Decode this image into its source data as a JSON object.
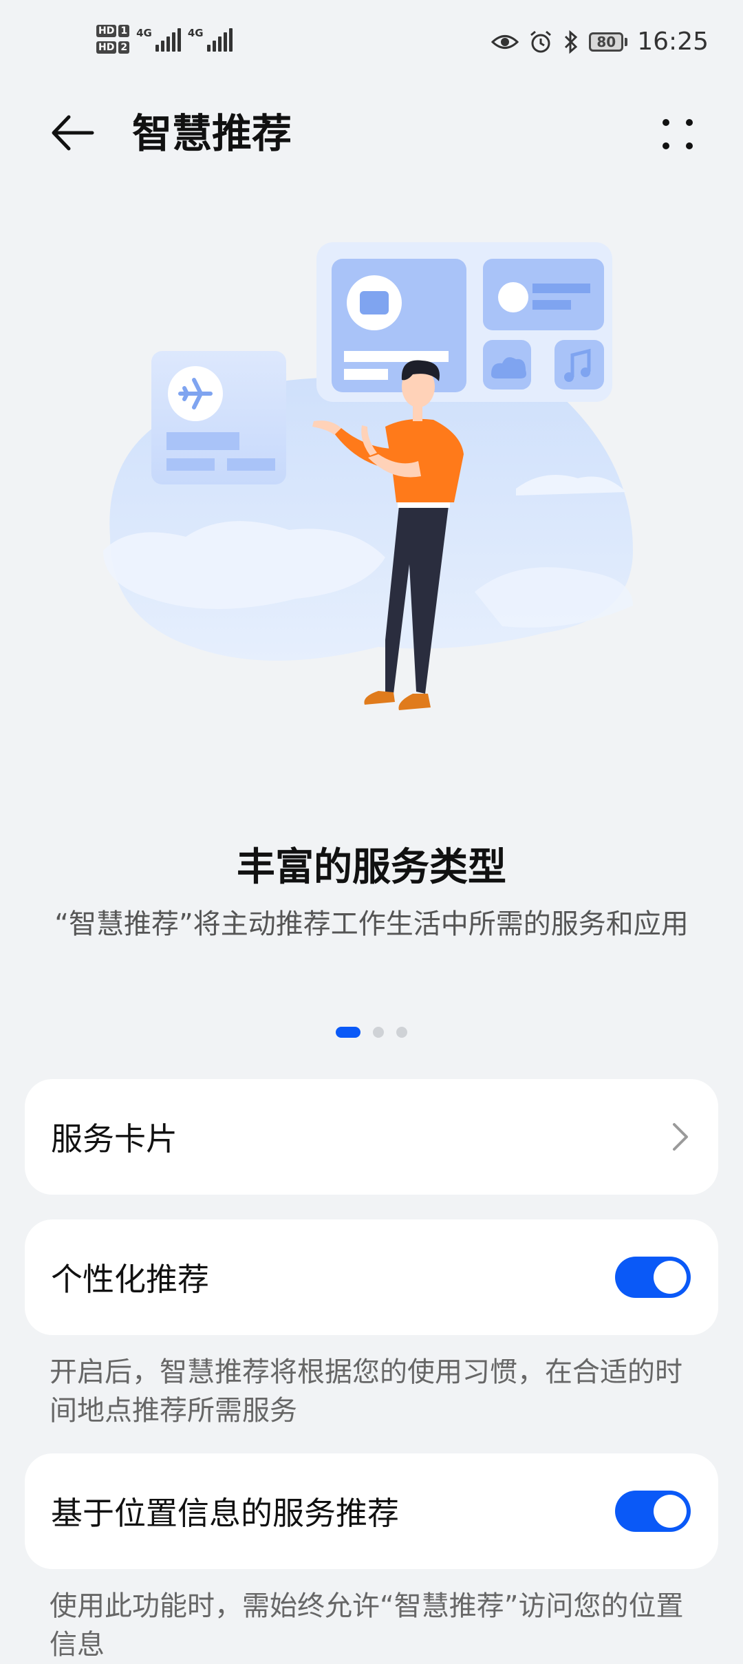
{
  "status_bar": {
    "sim1": {
      "hd": "HD",
      "num": "1"
    },
    "sim2": {
      "hd": "HD",
      "num": "2"
    },
    "signal1_label": "4G",
    "signal2_label": "4G",
    "battery": "80",
    "time": "16:25"
  },
  "app_bar": {
    "title": "智慧推荐"
  },
  "slide": {
    "title": "丰富的服务类型",
    "description": "“智慧推荐”将主动推荐工作生活中所需的服务和应用",
    "page_count": 3,
    "active_index": 0
  },
  "settings": {
    "service_cards": {
      "label": "服务卡片"
    },
    "personalized": {
      "label": "个性化推荐",
      "enabled": true,
      "note": "开启后，智慧推荐将根据您的使用习惯，在合适的时间地点推荐所需服务"
    },
    "location_based": {
      "label": "基于位置信息的服务推荐",
      "enabled": true,
      "note": "使用此功能时，需始终允许“智慧推荐”访问您的位置信息"
    }
  },
  "colors": {
    "accent": "#0a59f7",
    "background": "#f1f3f5",
    "card": "#ffffff"
  }
}
